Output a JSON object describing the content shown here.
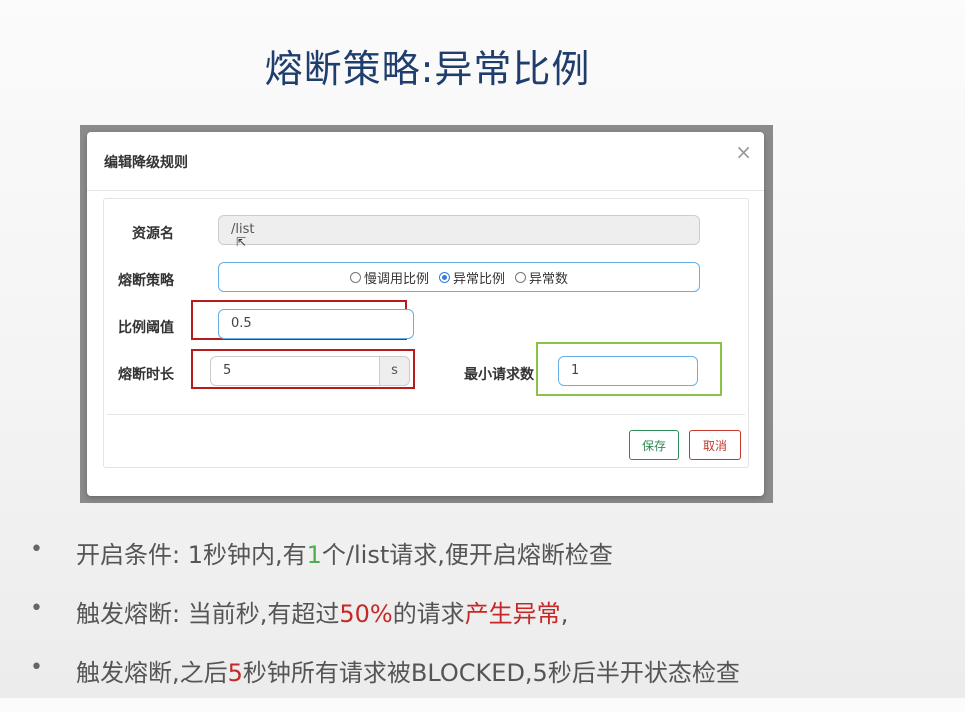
{
  "slide": {
    "title": "熔断策略:异常比例"
  },
  "dialog": {
    "title": "编辑降级规则",
    "close_label": "×",
    "fields": {
      "resource": {
        "label": "资源名",
        "value": "/list"
      },
      "strategy": {
        "label": "熔断策略",
        "options": [
          {
            "label": "慢调用比例",
            "selected": false
          },
          {
            "label": "异常比例",
            "selected": true
          },
          {
            "label": "异常数",
            "selected": false
          }
        ]
      },
      "ratio": {
        "label": "比例阈值",
        "value": "0.5"
      },
      "duration": {
        "label": "熔断时长",
        "value": "5",
        "unit": "s"
      },
      "min_requests": {
        "label": "最小请求数",
        "value": "1"
      }
    },
    "buttons": {
      "save": "保存",
      "cancel": "取消"
    }
  },
  "bullets": [
    {
      "parts": [
        "开启条件: 1秒钟内,有",
        "1",
        "个/list请求,便开启熔断检查"
      ]
    },
    {
      "parts": [
        "触发熔断: 当前秒,有超过",
        "50%",
        "的请求",
        "产生异常",
        ","
      ]
    },
    {
      "parts": [
        "触发熔断,之后",
        "5",
        "秒钟所有请求被BLOCKED,5秒后半开状态检查"
      ]
    }
  ],
  "colors": {
    "title": "#1f3e6d",
    "highlight_red": "#c62828",
    "highlight_green": "#4caf50",
    "box_red": "#b71c1c",
    "box_green": "#8bc34a"
  }
}
